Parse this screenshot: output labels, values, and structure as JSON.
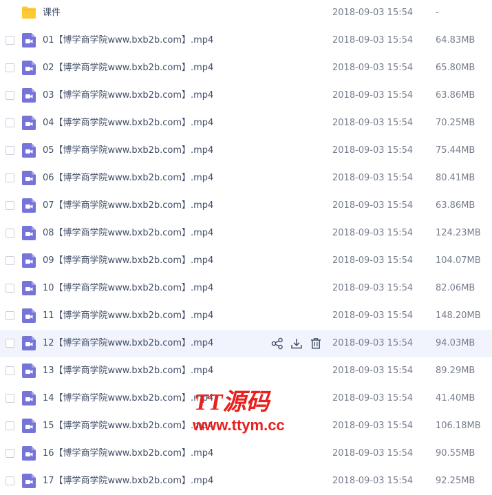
{
  "files": [
    {
      "type": "folder",
      "icon": "folder-icon",
      "name": "课件",
      "date": "2018-09-03 15:54",
      "size": "-"
    },
    {
      "type": "video",
      "icon": "video-file-icon",
      "name": "01【博学商学院www.bxb2b.com】.mp4",
      "date": "2018-09-03 15:54",
      "size": "64.83MB"
    },
    {
      "type": "video",
      "icon": "video-file-icon",
      "name": "02【博学商学院www.bxb2b.com】.mp4",
      "date": "2018-09-03 15:54",
      "size": "65.80MB"
    },
    {
      "type": "video",
      "icon": "video-file-icon",
      "name": "03【博学商学院www.bxb2b.com】.mp4",
      "date": "2018-09-03 15:54",
      "size": "63.86MB"
    },
    {
      "type": "video",
      "icon": "video-file-icon",
      "name": "04【博学商学院www.bxb2b.com】.mp4",
      "date": "2018-09-03 15:54",
      "size": "70.25MB"
    },
    {
      "type": "video",
      "icon": "video-file-icon",
      "name": "05【博学商学院www.bxb2b.com】.mp4",
      "date": "2018-09-03 15:54",
      "size": "75.44MB"
    },
    {
      "type": "video",
      "icon": "video-file-icon",
      "name": "06【博学商学院www.bxb2b.com】.mp4",
      "date": "2018-09-03 15:54",
      "size": "80.41MB"
    },
    {
      "type": "video",
      "icon": "video-file-icon",
      "name": "07【博学商学院www.bxb2b.com】.mp4",
      "date": "2018-09-03 15:54",
      "size": "63.86MB"
    },
    {
      "type": "video",
      "icon": "video-file-icon",
      "name": "08【博学商学院www.bxb2b.com】.mp4",
      "date": "2018-09-03 15:54",
      "size": "124.23MB"
    },
    {
      "type": "video",
      "icon": "video-file-icon",
      "name": "09【博学商学院www.bxb2b.com】.mp4",
      "date": "2018-09-03 15:54",
      "size": "104.07MB"
    },
    {
      "type": "video",
      "icon": "video-file-icon",
      "name": "10【博学商学院www.bxb2b.com】.mp4",
      "date": "2018-09-03 15:54",
      "size": "82.06MB"
    },
    {
      "type": "video",
      "icon": "video-file-icon",
      "name": "11【博学商学院www.bxb2b.com】.mp4",
      "date": "2018-09-03 15:54",
      "size": "148.20MB"
    },
    {
      "type": "video",
      "icon": "video-file-icon",
      "name": "12【博学商学院www.bxb2b.com】.mp4",
      "date": "2018-09-03 15:54",
      "size": "94.03MB",
      "hovered": true
    },
    {
      "type": "video",
      "icon": "video-file-icon",
      "name": "13【博学商学院www.bxb2b.com】.mp4",
      "date": "2018-09-03 15:54",
      "size": "89.29MB"
    },
    {
      "type": "video",
      "icon": "video-file-icon",
      "name": "14【博学商学院www.bxb2b.com】.mp4",
      "date": "2018-09-03 15:54",
      "size": "41.40MB"
    },
    {
      "type": "video",
      "icon": "video-file-icon",
      "name": "15【博学商学院www.bxb2b.com】.mp4",
      "date": "2018-09-03 15:54",
      "size": "106.18MB"
    },
    {
      "type": "video",
      "icon": "video-file-icon",
      "name": "16【博学商学院www.bxb2b.com】.mp4",
      "date": "2018-09-03 15:54",
      "size": "90.55MB"
    },
    {
      "type": "video",
      "icon": "video-file-icon",
      "name": "17【博学商学院www.bxb2b.com】.mp4",
      "date": "2018-09-03 15:54",
      "size": "92.25MB"
    }
  ],
  "row_actions": [
    {
      "icon": "share-icon"
    },
    {
      "icon": "download-icon"
    },
    {
      "icon": "delete-icon"
    }
  ],
  "watermark": {
    "line1": "TT源码",
    "line2": "www.ttym.cc"
  },
  "colors": {
    "folder": "#ffc933",
    "video": "#7674d9",
    "hover_row": "#f1f4fc",
    "text": "#424e67",
    "meta_text": "#767d8d",
    "watermark": "#e8201e"
  }
}
